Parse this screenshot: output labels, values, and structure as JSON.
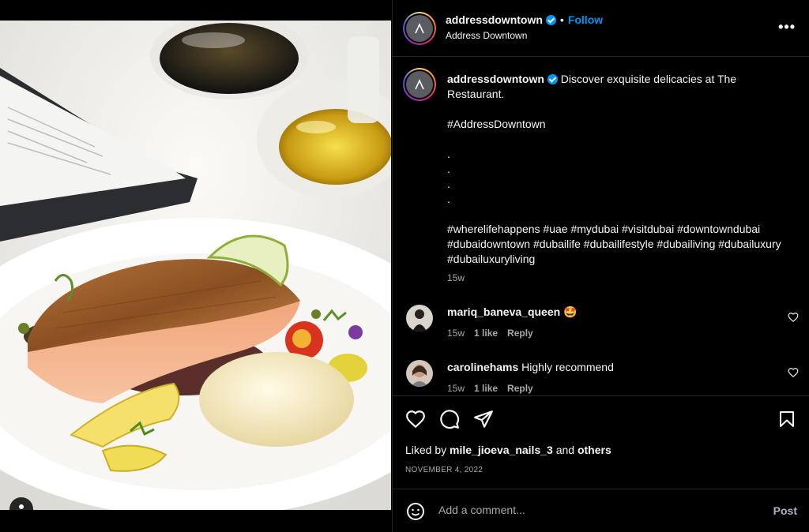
{
  "post": {
    "username": "addressdowntown",
    "follow_label": "Follow",
    "dot": "•",
    "location": "Address Downtown",
    "more_label": "•••"
  },
  "caption": {
    "username": "addressdowntown",
    "text": "Discover exquisite delicacies at The Restaurant.\n\n#AddressDowntown\n\n.\n.\n.\n.\n\n#wherelifehappens #uae #mydubai #visitdubai #downtowndubai #dubaidowntown #dubailife #dubailifestyle #dubailiving #dubailuxury #dubailuxuryliving",
    "time": "15w"
  },
  "comments": [
    {
      "username": "mariq_baneva_queen",
      "text": "🤩",
      "time": "15w",
      "likes": "1 like",
      "reply": "Reply"
    },
    {
      "username": "carolinehams",
      "text": "Highly recommend",
      "time": "15w",
      "likes": "1 like",
      "reply": "Reply"
    }
  ],
  "likes": {
    "prefix": "Liked by",
    "user": "mile_jioeva_nails_3",
    "and": "and",
    "others": "others"
  },
  "date": "NOVEMBER 4, 2022",
  "comment_box": {
    "placeholder": "Add a comment...",
    "post_label": "Post"
  },
  "colors": {
    "accent": "#0095f6",
    "background": "#000000",
    "muted": "#a8a8a8"
  },
  "icons": [
    "heart-icon",
    "comment-icon",
    "share-icon",
    "bookmark-icon",
    "emoji-icon",
    "user-tag-icon",
    "verified-icon",
    "more-options-icon"
  ]
}
